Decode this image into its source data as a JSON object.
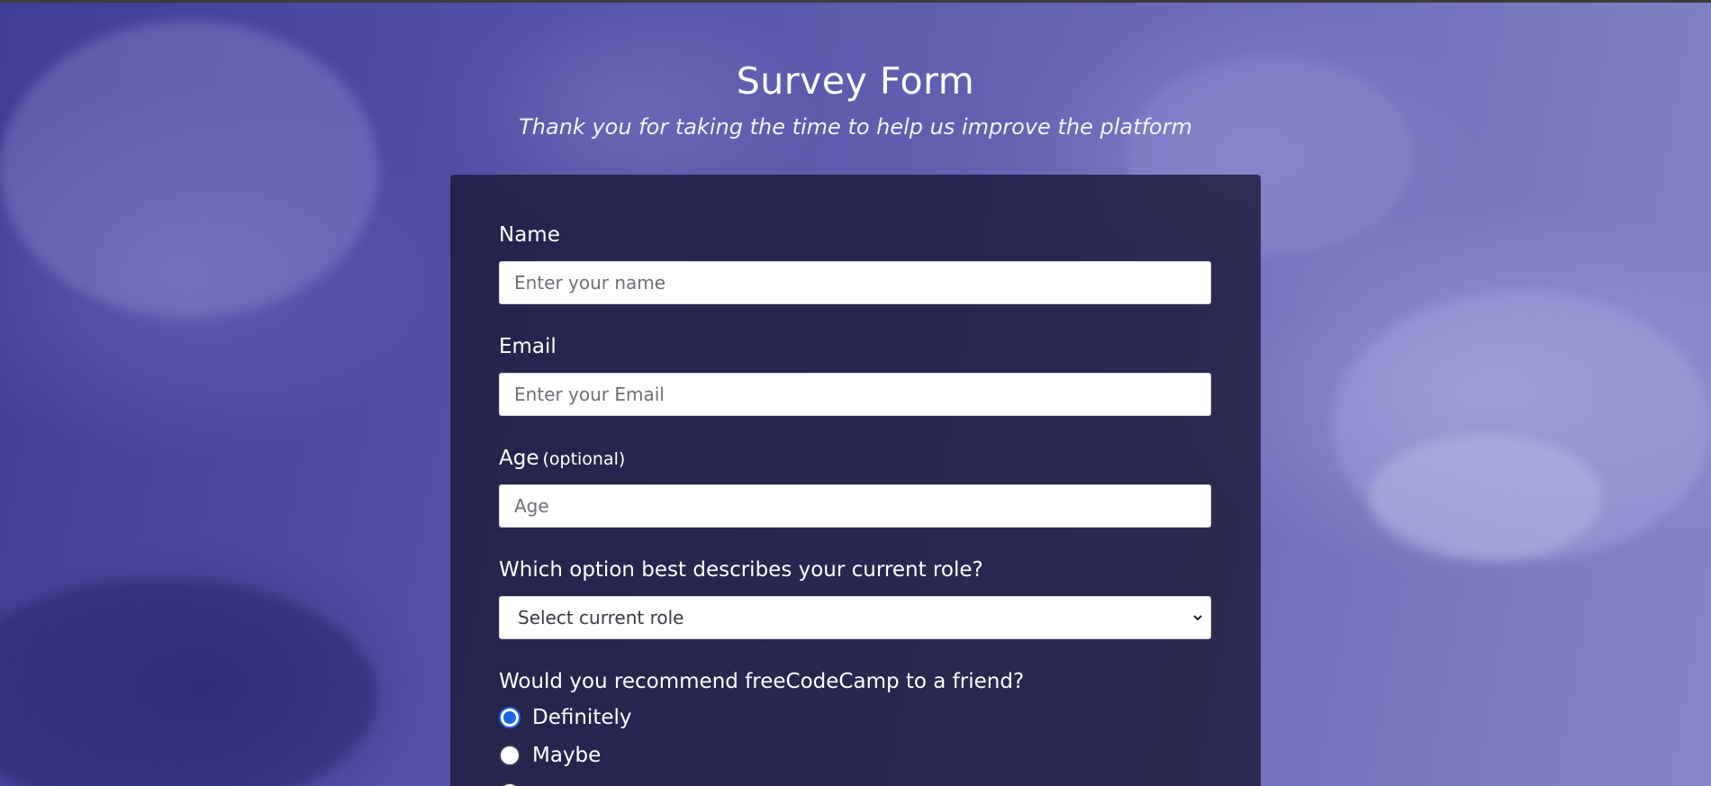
{
  "header": {
    "title": "Survey Form",
    "description": "Thank you for taking the time to help us improve the platform"
  },
  "form": {
    "name": {
      "label": "Name",
      "placeholder": "Enter your name",
      "value": ""
    },
    "email": {
      "label": "Email",
      "placeholder": "Enter your Email",
      "value": ""
    },
    "age": {
      "label": "Age",
      "label_note": "(optional)",
      "placeholder": "Age",
      "value": ""
    },
    "role": {
      "label": "Which option best describes your current role?",
      "selected": "Select current role"
    },
    "recommend": {
      "label": "Would you recommend freeCodeCamp to a friend?",
      "options": [
        {
          "label": "Definitely",
          "checked": true
        },
        {
          "label": "Maybe",
          "checked": false
        }
      ]
    }
  },
  "colors": {
    "panel": "#1b1b3a",
    "radio_accent": "#1a66e8",
    "background": "#4b4a9a"
  }
}
